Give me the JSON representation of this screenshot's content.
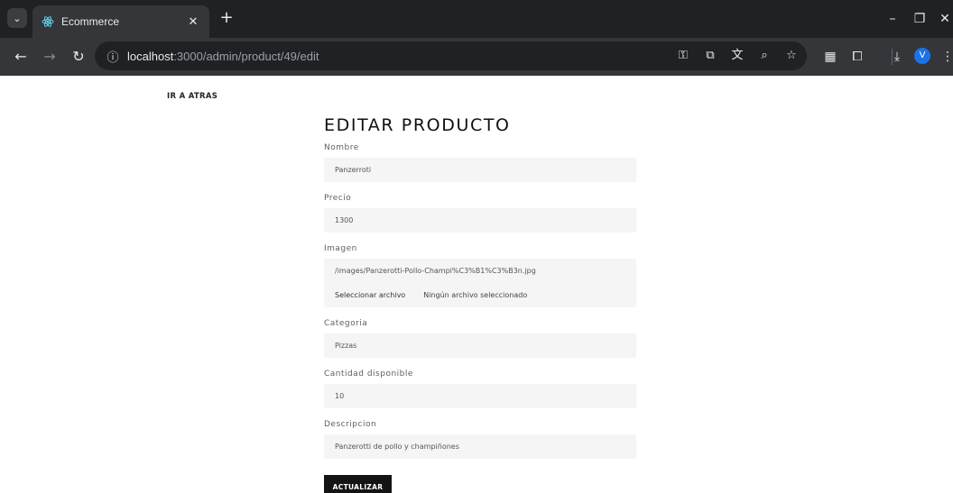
{
  "browser": {
    "tab_title": "Ecommerce",
    "url_host": "localhost",
    "url_path": ":3000/admin/product/49/edit",
    "profile_initial": "V"
  },
  "page": {
    "back_link": "IR A ATRAS",
    "title": "EDITAR PRODUCTO",
    "fields": {
      "nombre": {
        "label": "Nombre",
        "value": "Panzerroti"
      },
      "precio": {
        "label": "Precio",
        "value": "1300"
      },
      "imagen": {
        "label": "Imagen",
        "value": "/images/Panzerotti-Pollo-Champi%C3%B1%C3%B3n.jpg",
        "file_button": "Seleccionar archivo",
        "file_status": "Ningún archivo seleccionado"
      },
      "categoria": {
        "label": "Categoria",
        "value": "Pizzas"
      },
      "cantidad": {
        "label": "Cantidad disponible",
        "value": "10"
      },
      "descripcion": {
        "label": "Descripcion",
        "value": "Panzerotti de pollo y champiñones"
      }
    },
    "submit_label": "ACTUALIZAR"
  }
}
